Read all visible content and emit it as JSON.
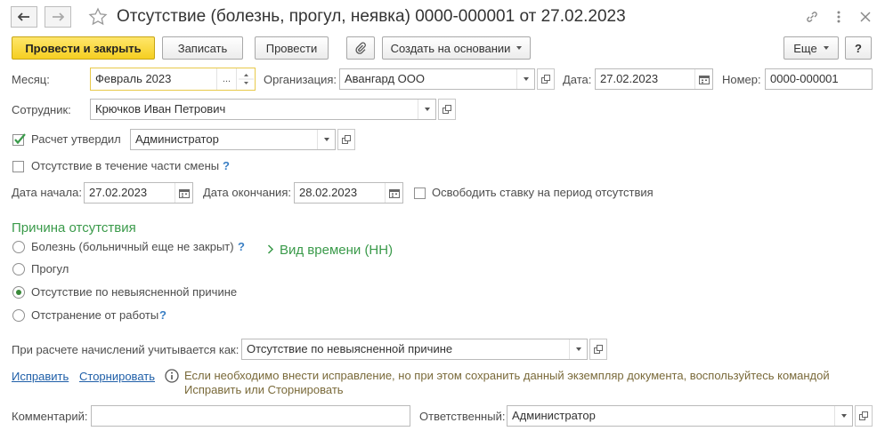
{
  "header": {
    "title": "Отсутствие (болезнь, прогул, неявка) 0000-000001 от 27.02.2023"
  },
  "toolbar": {
    "post_close": "Провести и закрыть",
    "save": "Записать",
    "post": "Провести",
    "create_based": "Создать на основании",
    "more": "Еще",
    "help": "?"
  },
  "form": {
    "month_label": "Месяц:",
    "month_value": "Февраль 2023",
    "org_label": "Организация:",
    "org_value": "Авангард ООО",
    "date_label": "Дата:",
    "date_value": "27.02.2023",
    "number_label": "Номер:",
    "number_value": "0000-000001",
    "employee_label": "Сотрудник:",
    "employee_value": "Крючков Иван Петрович",
    "approved_label": "Расчет утвердил",
    "approved_value": "Администратор",
    "partial_shift_label": "Отсутствие в течение части смены",
    "start_label": "Дата начала:",
    "start_value": "27.02.2023",
    "end_label": "Дата окончания:",
    "end_value": "28.02.2023",
    "free_rate_label": "Освободить ставку на период отсутствия"
  },
  "reason": {
    "heading": "Причина отсутствия",
    "time_kind": "Вид времени (НН)",
    "options": [
      "Болезнь (больничный еще не закрыт)",
      "Прогул",
      "Отсутствие по невыясненной причине",
      "Отстранение от работы"
    ],
    "selected_index": 2
  },
  "accrual": {
    "label": "При расчете начислений учитывается как:",
    "value": "Отсутствие по невыясненной причине"
  },
  "links": {
    "fix": "Исправить",
    "reverse": "Сторнировать",
    "info": "Если необходимо внести исправление, но при этом сохранить данный экземпляр документа, воспользуйтесь командой Исправить или Сторнировать"
  },
  "footer": {
    "comment_label": "Комментарий:",
    "comment_value": "",
    "responsible_label": "Ответственный:",
    "responsible_value": "Администратор"
  },
  "colors": {
    "accent_green": "#3a9a4a",
    "primary_yellow": "#f5cf21",
    "link_blue": "#1f5fa8",
    "info_text": "#7a6a3a"
  }
}
